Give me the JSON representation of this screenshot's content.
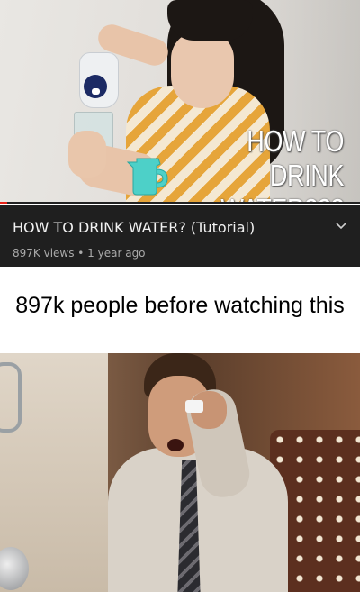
{
  "thumbnail": {
    "overlay_title": "HOW TO DRINK WATER???",
    "progress_fraction": 0.02,
    "progress_color": "#e62117",
    "mascot_icon": "pitcher-icon",
    "mascot_color": "#4dd0c8"
  },
  "video": {
    "title": "HOW TO DRINK WATER? (Tutorial)",
    "meta": "897K views • 1 year ago",
    "expand_icon": "chevron-down-icon"
  },
  "meme": {
    "caption": "897k people before watching this"
  }
}
